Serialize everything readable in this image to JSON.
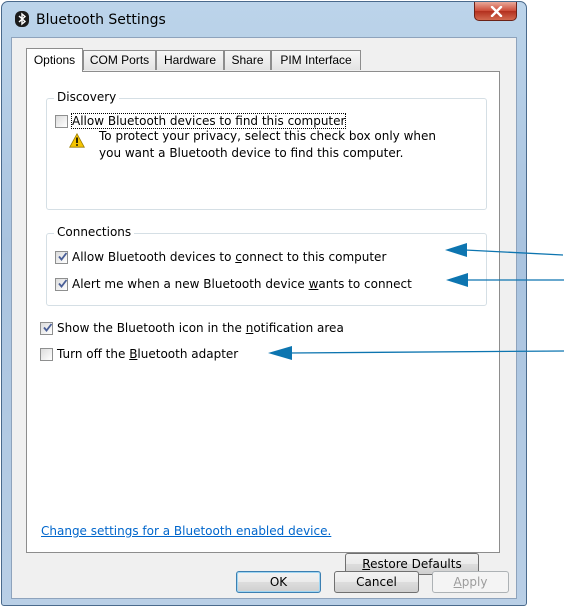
{
  "window": {
    "title": "Bluetooth Settings",
    "icon": "bluetooth-icon",
    "close_icon": "close-icon"
  },
  "tabs": [
    {
      "label": "Options",
      "active": true
    },
    {
      "label": "COM Ports",
      "active": false
    },
    {
      "label": "Hardware",
      "active": false
    },
    {
      "label": "Share",
      "active": false
    },
    {
      "label": "PIM Interface",
      "active": false
    }
  ],
  "discovery": {
    "title": "Discovery",
    "allow_find": {
      "label": "Allow Bluetooth devices to find this computer",
      "checked": false
    },
    "warning_icon": "warning-icon",
    "warning_line1": "To protect your privacy, select this check box only when",
    "warning_line2": "you want a Bluetooth device to find this computer."
  },
  "connections": {
    "title": "Connections",
    "allow_connect": {
      "label_pre": "Allow Bluetooth devices to ",
      "label_key": "c",
      "label_post": "onnect to this computer",
      "checked": true
    },
    "alert_new": {
      "label_pre": "Alert me when a new Bluetooth device ",
      "label_key": "w",
      "label_post": "ants to connect",
      "checked": true
    }
  },
  "show_icon": {
    "label_pre": "Show the Bluetooth icon in the ",
    "label_key": "n",
    "label_post": "otification area",
    "checked": true
  },
  "turn_off": {
    "label_pre": "Turn off the ",
    "label_key": "B",
    "label_post": "luetooth adapter",
    "checked": false
  },
  "link": "Change settings for a Bluetooth enabled device.",
  "buttons": {
    "restore_key": "R",
    "restore_rest": "estore Defaults",
    "ok": "OK",
    "cancel": "Cancel",
    "apply_key": "A",
    "apply_rest": "pply"
  },
  "colors": {
    "arrow": "#0d75b0",
    "link": "#0066cc"
  }
}
